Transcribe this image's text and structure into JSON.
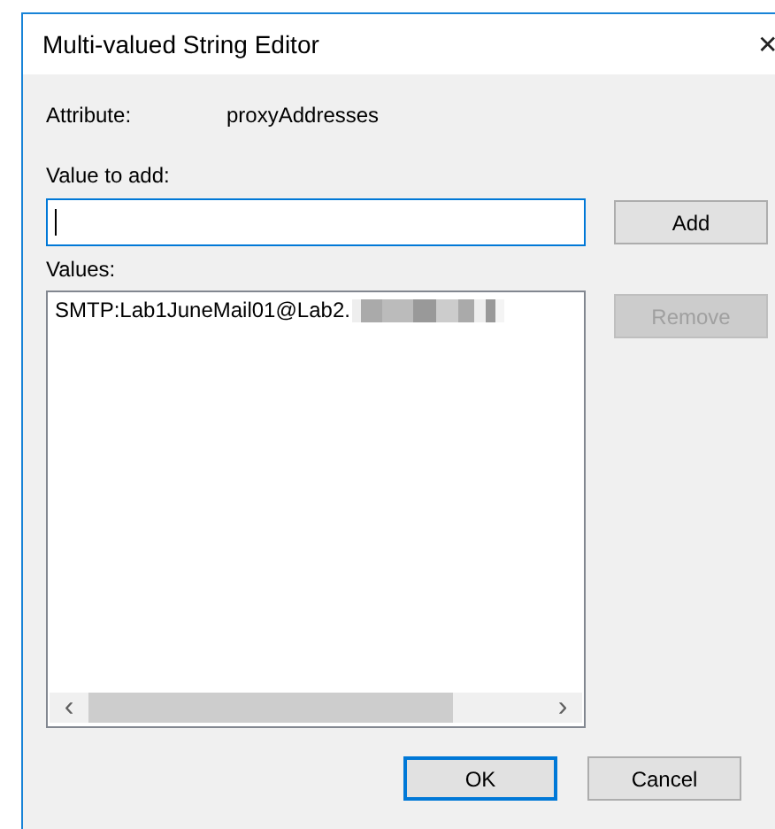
{
  "window": {
    "title": "Multi-valued String Editor",
    "close_glyph": "✕"
  },
  "attribute": {
    "label": "Attribute:",
    "value": "proxyAddresses"
  },
  "value_to_add": {
    "label": "Value to add:",
    "focused": true
  },
  "add_button": {
    "label": "Add",
    "disabled": false,
    "default": false
  },
  "values": {
    "label": "Values:",
    "items": [
      {
        "text": "SMTP:Lab1JuneMail01@Lab2.",
        "redacted_tail": true,
        "selected": false
      }
    ],
    "scroll_left": "‹",
    "scroll_right": "›"
  },
  "remove_button": {
    "label": "Remove",
    "disabled": true,
    "default": false
  },
  "footer_buttons": [
    {
      "label": "OK",
      "disabled": false,
      "default": true
    },
    {
      "label": "Cancel",
      "disabled": false,
      "default": false
    }
  ]
}
